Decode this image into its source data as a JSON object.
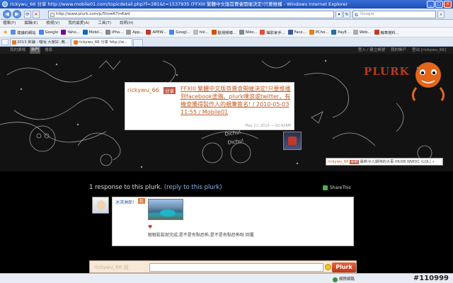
{
  "window": {
    "title": "rickywu_66 分享 http://www.mobile01.com/topicdetail.php?f=281&t=1537935 (FFXIII 繁體中文版首賣會開催決定!只要推播 - Windows Internet Explorer",
    "min": "_",
    "max": "□",
    "close": "×"
  },
  "address": {
    "url": "http://www.plurk.com/p/5hsw67m6wd",
    "search_placeholder": "Google",
    "back": "◀",
    "forward": "▶"
  },
  "menu": [
    "檔案(F)",
    "編輯(E)",
    "檢視(V)",
    "我的最愛(A)",
    "工具(T)",
    "說明(H)"
  ],
  "favorites": [
    "建議的網站",
    "Google",
    "Yaho...",
    "Mobil...",
    "iPho...",
    "App...",
    "APEW...",
    "Googl...",
    "hiii...",
    "歐視頻博...",
    "Niko...",
    "攝影家手...",
    "Face...",
    "PCho...",
    "PayE...",
    "Web...",
    "機車搭料..."
  ],
  "tabs": [
    {
      "label": "2013 來鋪 - 喵咕 大家好..教..."
    },
    {
      "label": "rickywu_66 分享 http://w..."
    }
  ],
  "topnav": {
    "left": [
      "我的廣場",
      "熱門",
      "搜尋"
    ],
    "right": [
      "登入 / 建立帳號",
      "我的帳戶",
      "登出 [rickywu_66]"
    ]
  },
  "brand": "PLURK",
  "plurk": {
    "user": "rickywu_66",
    "qualifier": "分享",
    "content": "FFXIII 繁體中文版首賣會開催決定!只要推播到facebook塗鴉、plurk噗浪或twitter，有機會獲得製作人的親筆簽名! / 2010-05-03 11:55 / Mobile01",
    "timestamp": "May 11, 2010 — 02:41AM"
  },
  "recent": {
    "user": "rickywu_66",
    "qualifier": "喜歡",
    "text": "最新令人期待的大事 06/08 WWDC (LOL) »"
  },
  "responses": {
    "count_text": "1 response to this plurk.",
    "reply_link": "(reply to this plurk)",
    "share": "ShareThis"
  },
  "comment": {
    "user": "冰淇淋郎!",
    "qualifier": "說",
    "heart": "♥",
    "text": "輕輕鬆鬆就完成,是不是有點恐怖,是不是有點恐怖呀 回覆",
    "link": "回覆"
  },
  "reply": {
    "ghost": "rickywu_66 說",
    "button": "Plurk"
  },
  "status": {
    "zone": "網際網路",
    "watermark": "#110999"
  }
}
